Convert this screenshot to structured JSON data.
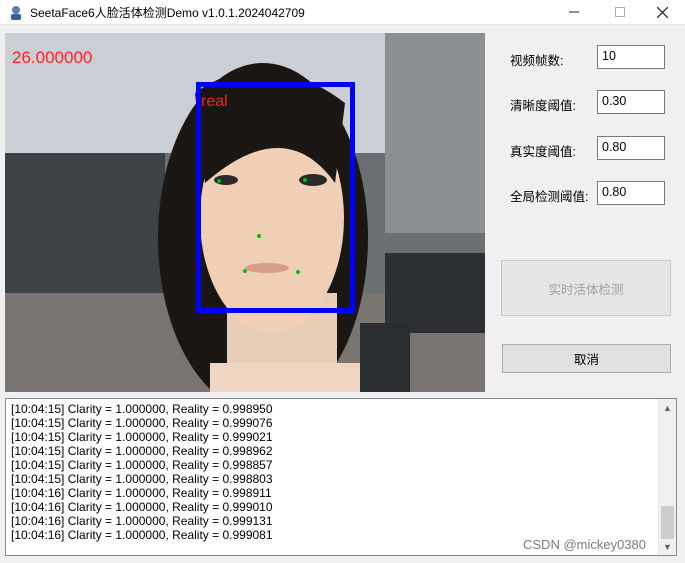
{
  "window": {
    "title": "SeetaFace6人脸活体检测Demo v1.0.1.2024042709"
  },
  "video": {
    "fps_text": "26.000000",
    "face_label": "real"
  },
  "settings": [
    {
      "label": "视频帧数:",
      "value": "10"
    },
    {
      "label": "清晰度阈值:",
      "value": "0.30"
    },
    {
      "label": "真实度阈值:",
      "value": "0.80"
    },
    {
      "label": "全局检测阈值:",
      "value": "0.80"
    }
  ],
  "buttons": {
    "detect": "实时活体检测",
    "cancel": "取消"
  },
  "log": {
    "lines": [
      "[10:04:15] Clarity = 1.000000, Reality = 0.998950",
      "[10:04:15] Clarity = 1.000000, Reality = 0.999076",
      "[10:04:15] Clarity = 1.000000, Reality = 0.999021",
      "[10:04:15] Clarity = 1.000000, Reality = 0.998962",
      "[10:04:15] Clarity = 1.000000, Reality = 0.998857",
      "[10:04:15] Clarity = 1.000000, Reality = 0.998803",
      "[10:04:16] Clarity = 1.000000, Reality = 0.998911",
      "[10:04:16] Clarity = 1.000000, Reality = 0.999010",
      "[10:04:16] Clarity = 1.000000, Reality = 0.999131",
      "[10:04:16] Clarity = 1.000000, Reality = 0.999081"
    ]
  },
  "watermark": "CSDN @mickey0380"
}
